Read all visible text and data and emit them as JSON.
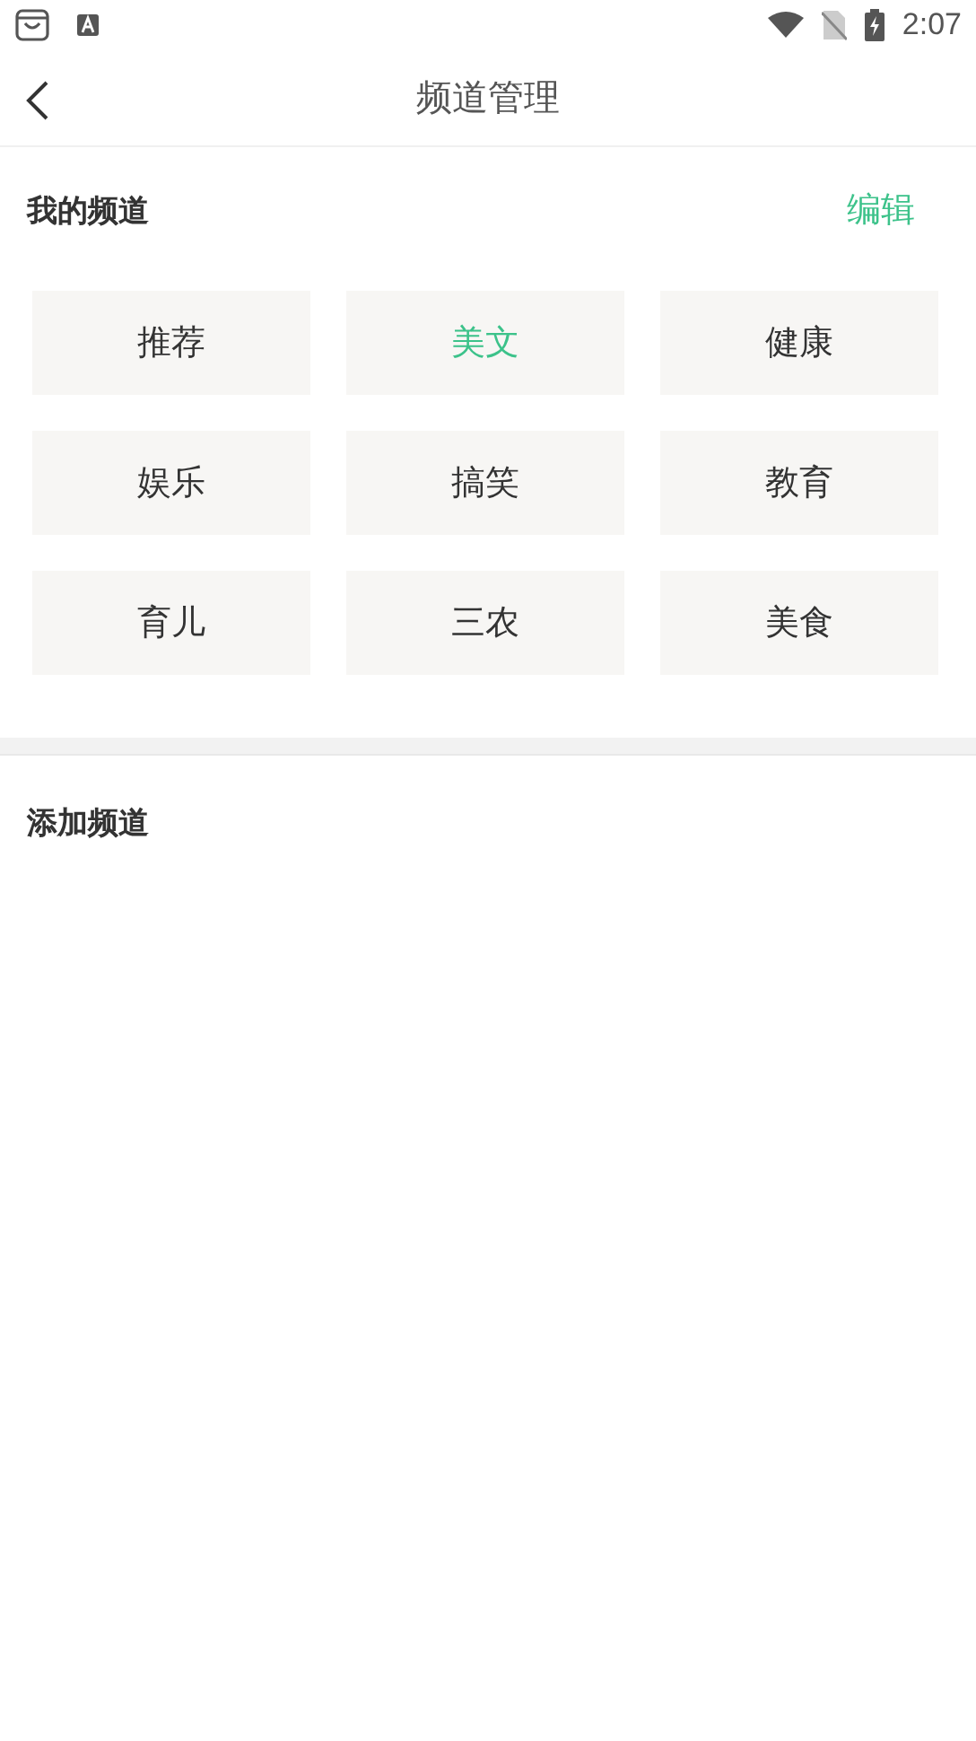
{
  "status_bar": {
    "time": "2:07"
  },
  "nav": {
    "title": "频道管理"
  },
  "my_channels": {
    "title": "我的频道",
    "edit": "编辑",
    "channels": [
      {
        "label": "推荐",
        "selected": false
      },
      {
        "label": "美文",
        "selected": true
      },
      {
        "label": "健康",
        "selected": false
      },
      {
        "label": "娱乐",
        "selected": false
      },
      {
        "label": "搞笑",
        "selected": false
      },
      {
        "label": "教育",
        "selected": false
      },
      {
        "label": "育儿",
        "selected": false
      },
      {
        "label": "三农",
        "selected": false
      },
      {
        "label": "美食",
        "selected": false
      }
    ]
  },
  "add_channels": {
    "title": "添加频道"
  }
}
